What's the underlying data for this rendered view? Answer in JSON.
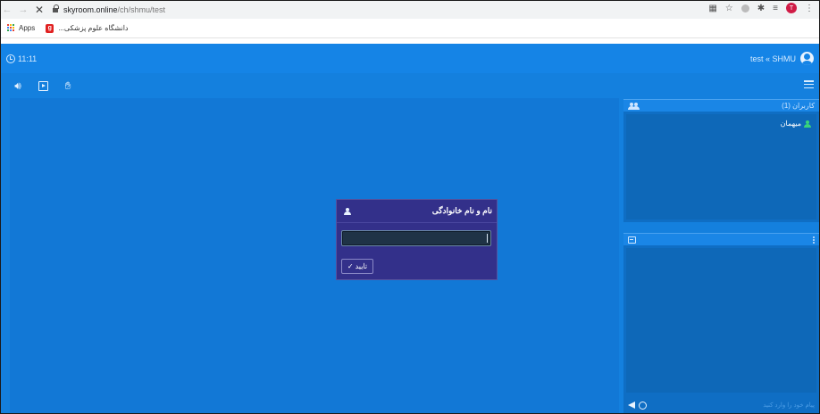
{
  "browser": {
    "url_host": "skyroom.online",
    "url_path": "/ch/shmu/test",
    "profile_initial": "T",
    "bookmarks": {
      "apps_label": "Apps",
      "item_label": "دانشگاه علوم پزشکی..."
    }
  },
  "header": {
    "time": "11:11",
    "room_title": "test « SHMU"
  },
  "users_panel": {
    "title": "کاربران (1)",
    "users": [
      {
        "name": "میهمان"
      }
    ]
  },
  "chat_panel": {
    "placeholder": "پیام خود را وارد کنید"
  },
  "modal": {
    "title": "نام و نام خانوادگی",
    "input_value": "",
    "confirm_label": "تایید"
  },
  "colors": {
    "app_bg": "#1480de",
    "topbar": "#1584e6",
    "modal_bg": "#33308a",
    "online_user": "#39d47a",
    "profile_badge": "#d01b46"
  },
  "icons": [
    "back-icon",
    "forward-icon",
    "close-icon",
    "lock-icon",
    "translate-icon",
    "star-icon",
    "extension-icon",
    "puzzle-icon",
    "playlist-icon",
    "menu-dots-icon",
    "clock-icon",
    "user-circle-icon",
    "speaker-icon",
    "play-box-icon",
    "hand-icon",
    "hamburger-icon",
    "users-group-icon",
    "person-icon",
    "chat-icon",
    "kebab-icon",
    "smile-icon",
    "send-icon",
    "check-icon"
  ]
}
